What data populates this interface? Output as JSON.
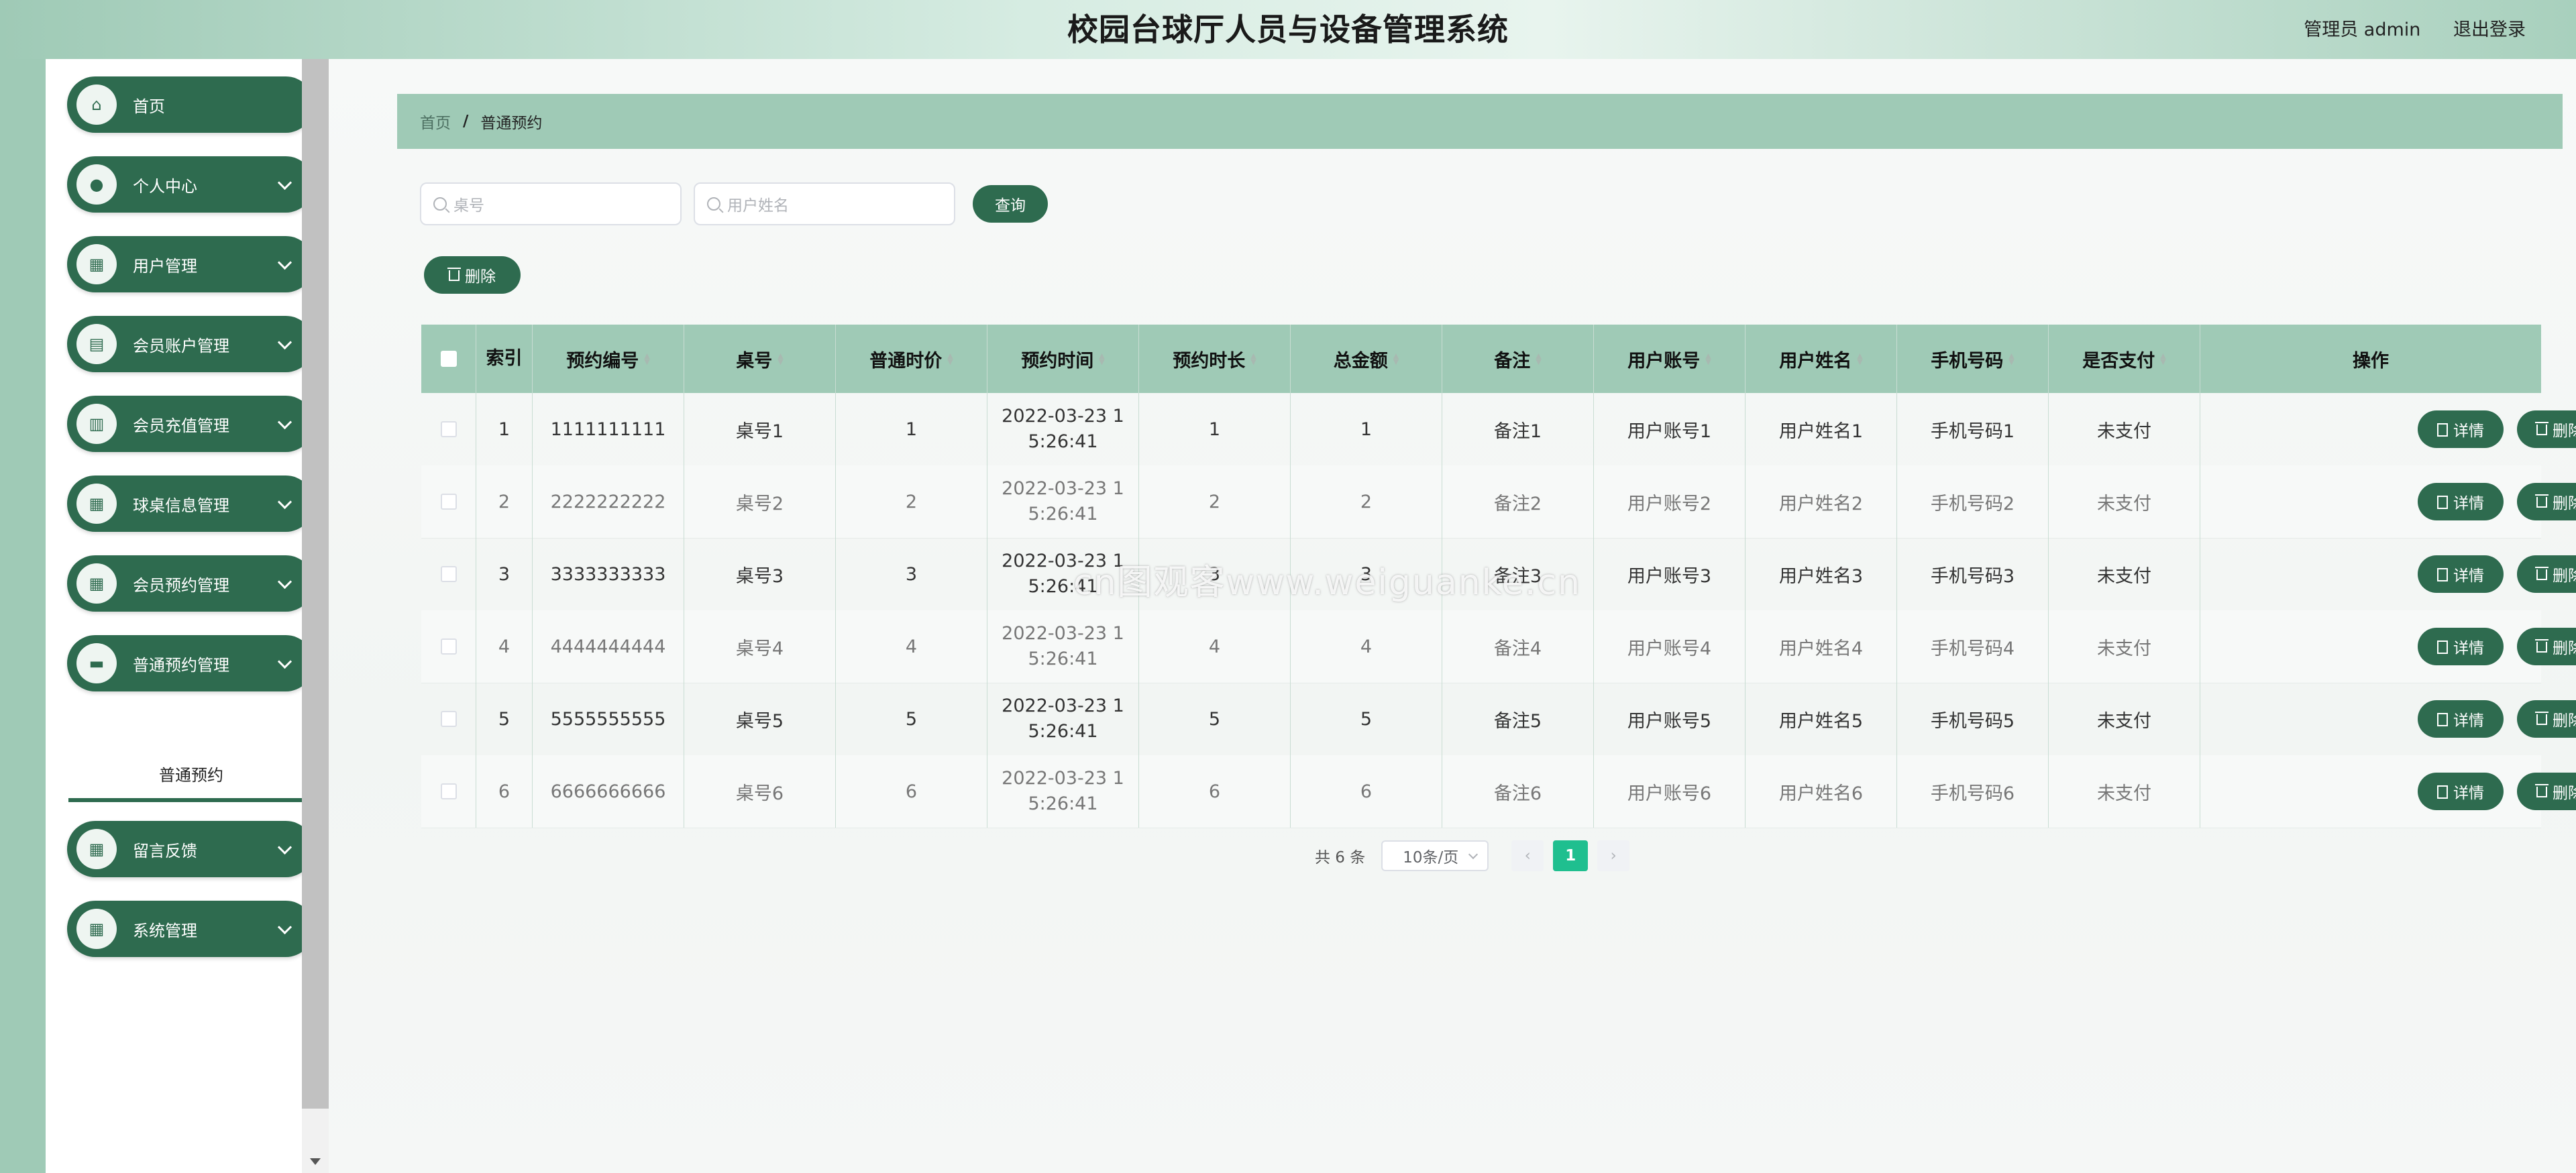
{
  "header": {
    "title": "校园台球厅人员与设备管理系统",
    "user_label": "管理员 admin",
    "logout_label": "退出登录"
  },
  "sidebar": {
    "items": [
      {
        "label": "首页",
        "icon": "home-icon"
      },
      {
        "label": "个人中心",
        "icon": "user-icon"
      },
      {
        "label": "用户管理",
        "icon": "grid-icon"
      },
      {
        "label": "会员账户管理",
        "icon": "card-icon"
      },
      {
        "label": "会员充值管理",
        "icon": "chart-icon"
      },
      {
        "label": "球桌信息管理",
        "icon": "apps-icon"
      },
      {
        "label": "会员预约管理",
        "icon": "grid-icon"
      },
      {
        "label": "普通预约管理",
        "icon": "printer-icon"
      },
      {
        "label": "留言反馈",
        "icon": "grid-icon"
      },
      {
        "label": "系统管理",
        "icon": "grid-icon"
      }
    ],
    "active_sub": "普通预约"
  },
  "breadcrumb": {
    "home": "首页",
    "separator": "/",
    "current": "普通预约"
  },
  "search": {
    "table_placeholder": "桌号",
    "name_placeholder": "用户姓名",
    "query_label": "查询",
    "delete_label": "删除"
  },
  "table": {
    "columns": [
      "索引",
      "预约编号",
      "桌号",
      "普通时价",
      "预约时间",
      "预约时长",
      "总金额",
      "备注",
      "用户账号",
      "用户姓名",
      "手机号码",
      "是否支付",
      "操作"
    ],
    "rows": [
      {
        "index": "1",
        "code": "1111111111",
        "table_no": "桌号1",
        "price": "1",
        "time_a": "2022-03-23 1",
        "time_b": "5:26:41",
        "duration": "1",
        "total": "1",
        "note": "备注1",
        "account": "用户账号1",
        "name": "用户姓名1",
        "phone": "手机号码1",
        "paid": "未支付"
      },
      {
        "index": "2",
        "code": "2222222222",
        "table_no": "桌号2",
        "price": "2",
        "time_a": "2022-03-23 1",
        "time_b": "5:26:41",
        "duration": "2",
        "total": "2",
        "note": "备注2",
        "account": "用户账号2",
        "name": "用户姓名2",
        "phone": "手机号码2",
        "paid": "未支付"
      },
      {
        "index": "3",
        "code": "3333333333",
        "table_no": "桌号3",
        "price": "3",
        "time_a": "2022-03-23 1",
        "time_b": "5:26:41",
        "duration": "3",
        "total": "3",
        "note": "备注3",
        "account": "用户账号3",
        "name": "用户姓名3",
        "phone": "手机号码3",
        "paid": "未支付"
      },
      {
        "index": "4",
        "code": "4444444444",
        "table_no": "桌号4",
        "price": "4",
        "time_a": "2022-03-23 1",
        "time_b": "5:26:41",
        "duration": "4",
        "total": "4",
        "note": "备注4",
        "account": "用户账号4",
        "name": "用户姓名4",
        "phone": "手机号码4",
        "paid": "未支付"
      },
      {
        "index": "5",
        "code": "5555555555",
        "table_no": "桌号5",
        "price": "5",
        "time_a": "2022-03-23 1",
        "time_b": "5:26:41",
        "duration": "5",
        "total": "5",
        "note": "备注5",
        "account": "用户账号5",
        "name": "用户姓名5",
        "phone": "手机号码5",
        "paid": "未支付"
      },
      {
        "index": "6",
        "code": "6666666666",
        "table_no": "桌号6",
        "price": "6",
        "time_a": "2022-03-23 1",
        "time_b": "5:26:41",
        "duration": "6",
        "total": "6",
        "note": "备注6",
        "account": "用户账号6",
        "name": "用户姓名6",
        "phone": "手机号码6",
        "paid": "未支付"
      }
    ],
    "detail_label": "详情",
    "delete_label": "删除"
  },
  "pagination": {
    "total": "共 6 条",
    "page_size": "10条/页",
    "current_page": "1"
  },
  "watermark": "cn图观客www.weiguanke.cn",
  "colors": {
    "primary": "#2e6b4f",
    "header_bg": "#9fcab6",
    "page_active": "#1fbf8f"
  }
}
